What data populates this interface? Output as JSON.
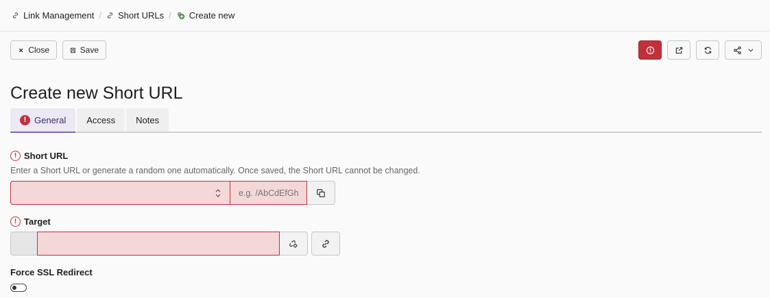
{
  "breadcrumb": {
    "items": [
      {
        "label": "Link Management",
        "icon": "link-icon"
      },
      {
        "label": "Short URLs",
        "icon": "link-icon"
      },
      {
        "label": "Create new",
        "icon": "add-green-icon"
      }
    ],
    "separator": "/"
  },
  "toolbar": {
    "close_label": "Close",
    "save_label": "Save",
    "icons": [
      "close-icon",
      "save-icon",
      "error-icon",
      "open-external-icon",
      "refresh-icon",
      "share-icon",
      "chevron-down-icon"
    ]
  },
  "page_title": "Create new Short URL",
  "tabs": [
    {
      "label": "General",
      "active": true,
      "has_error": true
    },
    {
      "label": "Access",
      "active": false
    },
    {
      "label": "Notes",
      "active": false
    }
  ],
  "form": {
    "short_url": {
      "label": "Short URL",
      "help": "Enter a Short URL or generate a random one automatically. Once saved, the Short URL cannot be changed.",
      "select_value": "",
      "placeholder": "e.g. /AbCdEfGh"
    },
    "target": {
      "label": "Target",
      "value": ""
    },
    "force_ssl": {
      "label": "Force SSL Redirect",
      "enabled": false
    }
  },
  "colors": {
    "danger": "#c2303a",
    "invalid_bg": "#f4d7d9",
    "tab_active": "#ece8f4",
    "tab_accent": "#7b68b5"
  }
}
